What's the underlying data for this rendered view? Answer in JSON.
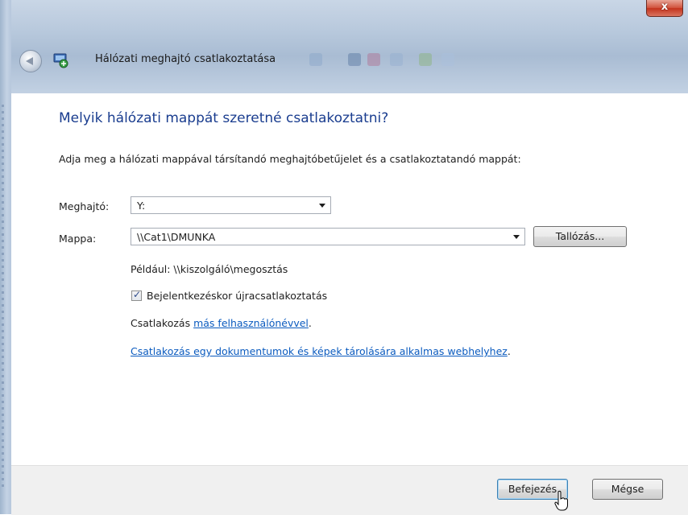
{
  "window": {
    "title": "Hálózati meghajtó csatlakoztatása",
    "close_glyph": "x"
  },
  "main": {
    "heading": "Melyik hálózati mappát szeretné csatlakoztatni?",
    "instruction": "Adja meg a hálózati mappával társítandó meghajtóbetűjelet és a csatlakoztatandó mappát:",
    "drive": {
      "label": "Meghajtó:",
      "value": "Y:"
    },
    "folder": {
      "label": "Mappa:",
      "value": "\\\\Cat1\\DMUNKA"
    },
    "browse_label": "Tallózás...",
    "example": "Például: \\\\kiszolgáló\\megosztás",
    "reconnect": {
      "label": "Bejelentkezéskor újracsatlakoztatás",
      "checked": true,
      "glyph": "✓"
    },
    "connect_prefix": "Csatlakozás ",
    "connect_link": "más felhasználónévvel",
    "connect_suffix": ".",
    "web_link": "Csatlakozás egy dokumentumok és képek tárolására alkalmas webhelyhez",
    "web_suffix": "."
  },
  "footer": {
    "finish_label": "Befejezés",
    "cancel_label": "Mégse"
  },
  "colors": {
    "heading": "#1a3d8f",
    "link": "#0b5bbf",
    "close": "#c3331d"
  },
  "icons": [
    "back-arrow-icon",
    "network-drive-icon",
    "close-icon",
    "dropdown-arrow-icon",
    "checkmark-icon",
    "mouse-cursor-icon"
  ]
}
